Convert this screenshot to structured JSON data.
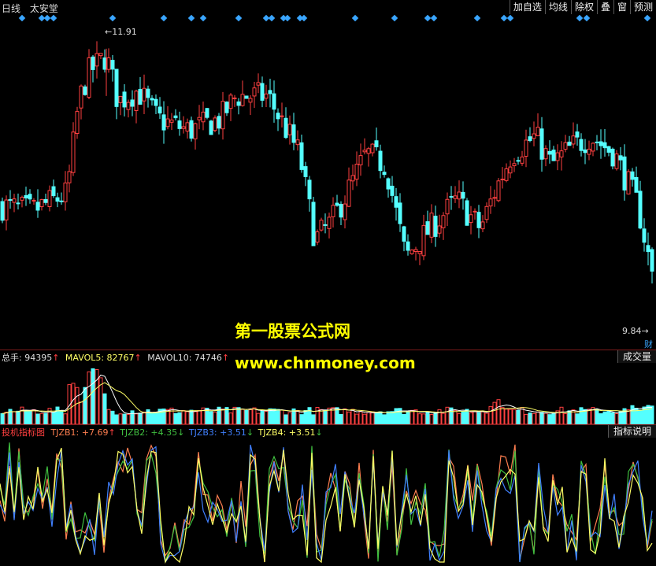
{
  "toolbar": {
    "period": "日线",
    "stock_name": "太安堂",
    "buttons": [
      "加自选",
      "均线",
      "除权",
      "叠",
      "窗",
      "预测"
    ]
  },
  "price_panel": {
    "high_label": "11.91",
    "low_label": "9.84",
    "cai_label": "财",
    "high": 11.91,
    "low": 9.84,
    "ylim": [
      9.3,
      12.1
    ]
  },
  "volume_panel": {
    "label_total": "总手: 94395",
    "label_mavol5": "MAVOL5: 82767",
    "label_mavol10": "MAVOL10: 74746",
    "button": "成交量"
  },
  "indicator_panel": {
    "name": "投机指标图",
    "tjzb1": "TJZB1: +7.69",
    "tjzb2": "TJZB2: +4.35",
    "tjzb3": "TJZB3: +3.51",
    "tjzb4": "TJZB4: +3.51",
    "button": "指标说明"
  },
  "watermark": {
    "line1": "第一股票公式网",
    "line2": "www.chnmoney.com"
  },
  "colors": {
    "up": "#ff4040",
    "down": "#54ffff",
    "diamond": "#3aa6ff",
    "tjzb1": "#ff7f50",
    "tjzb2": "#40c040",
    "tjzb3": "#4080ff",
    "tjzb4": "#ffff66"
  }
}
